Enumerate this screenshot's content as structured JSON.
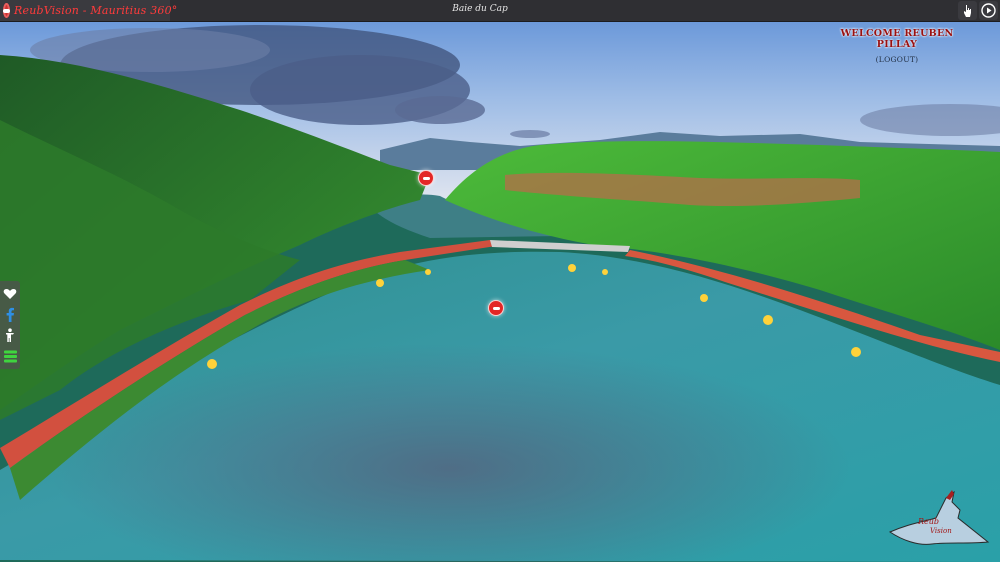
{
  "app": {
    "brand_title": "ReubVision - Mauritius 360°",
    "location_title": "Baie du Cap"
  },
  "user": {
    "welcome": "WELCOME REUBEN PILLAY",
    "logout": "(LOGOUT)"
  },
  "toolbar": {
    "icons": [
      "hand-pointer-icon",
      "play-icon"
    ]
  },
  "social": {
    "icons": [
      "heart-icon",
      "facebook-icon",
      "info-person-icon",
      "menu-icon"
    ]
  },
  "watermark": {
    "line1": "Reub",
    "line2": "Vision"
  },
  "colors": {
    "brand_red": "#ff3b3b",
    "hotspot_red": "#e32626",
    "topbar": "#2f2f33",
    "welcome_red": "#9a1010"
  }
}
